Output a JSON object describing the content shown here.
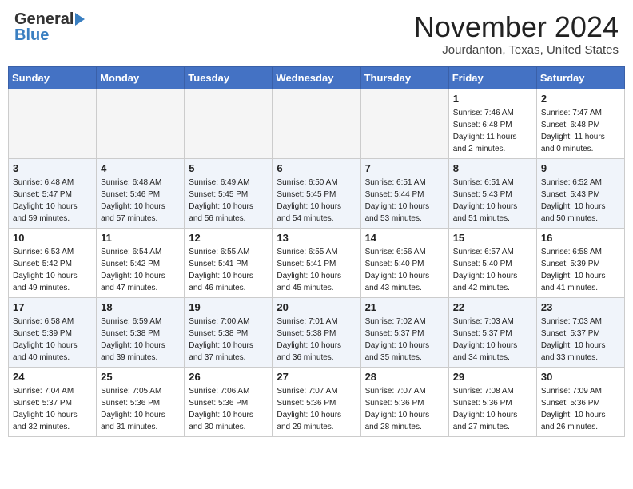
{
  "header": {
    "logo_general": "General",
    "logo_blue": "Blue",
    "month_title": "November 2024",
    "location": "Jourdanton, Texas, United States"
  },
  "weekdays": [
    "Sunday",
    "Monday",
    "Tuesday",
    "Wednesday",
    "Thursday",
    "Friday",
    "Saturday"
  ],
  "weeks": [
    [
      {
        "day": "",
        "info": ""
      },
      {
        "day": "",
        "info": ""
      },
      {
        "day": "",
        "info": ""
      },
      {
        "day": "",
        "info": ""
      },
      {
        "day": "",
        "info": ""
      },
      {
        "day": "1",
        "info": "Sunrise: 7:46 AM\nSunset: 6:48 PM\nDaylight: 11 hours\nand 2 minutes."
      },
      {
        "day": "2",
        "info": "Sunrise: 7:47 AM\nSunset: 6:48 PM\nDaylight: 11 hours\nand 0 minutes."
      }
    ],
    [
      {
        "day": "3",
        "info": "Sunrise: 6:48 AM\nSunset: 5:47 PM\nDaylight: 10 hours\nand 59 minutes."
      },
      {
        "day": "4",
        "info": "Sunrise: 6:48 AM\nSunset: 5:46 PM\nDaylight: 10 hours\nand 57 minutes."
      },
      {
        "day": "5",
        "info": "Sunrise: 6:49 AM\nSunset: 5:45 PM\nDaylight: 10 hours\nand 56 minutes."
      },
      {
        "day": "6",
        "info": "Sunrise: 6:50 AM\nSunset: 5:45 PM\nDaylight: 10 hours\nand 54 minutes."
      },
      {
        "day": "7",
        "info": "Sunrise: 6:51 AM\nSunset: 5:44 PM\nDaylight: 10 hours\nand 53 minutes."
      },
      {
        "day": "8",
        "info": "Sunrise: 6:51 AM\nSunset: 5:43 PM\nDaylight: 10 hours\nand 51 minutes."
      },
      {
        "day": "9",
        "info": "Sunrise: 6:52 AM\nSunset: 5:43 PM\nDaylight: 10 hours\nand 50 minutes."
      }
    ],
    [
      {
        "day": "10",
        "info": "Sunrise: 6:53 AM\nSunset: 5:42 PM\nDaylight: 10 hours\nand 49 minutes."
      },
      {
        "day": "11",
        "info": "Sunrise: 6:54 AM\nSunset: 5:42 PM\nDaylight: 10 hours\nand 47 minutes."
      },
      {
        "day": "12",
        "info": "Sunrise: 6:55 AM\nSunset: 5:41 PM\nDaylight: 10 hours\nand 46 minutes."
      },
      {
        "day": "13",
        "info": "Sunrise: 6:55 AM\nSunset: 5:41 PM\nDaylight: 10 hours\nand 45 minutes."
      },
      {
        "day": "14",
        "info": "Sunrise: 6:56 AM\nSunset: 5:40 PM\nDaylight: 10 hours\nand 43 minutes."
      },
      {
        "day": "15",
        "info": "Sunrise: 6:57 AM\nSunset: 5:40 PM\nDaylight: 10 hours\nand 42 minutes."
      },
      {
        "day": "16",
        "info": "Sunrise: 6:58 AM\nSunset: 5:39 PM\nDaylight: 10 hours\nand 41 minutes."
      }
    ],
    [
      {
        "day": "17",
        "info": "Sunrise: 6:58 AM\nSunset: 5:39 PM\nDaylight: 10 hours\nand 40 minutes."
      },
      {
        "day": "18",
        "info": "Sunrise: 6:59 AM\nSunset: 5:38 PM\nDaylight: 10 hours\nand 39 minutes."
      },
      {
        "day": "19",
        "info": "Sunrise: 7:00 AM\nSunset: 5:38 PM\nDaylight: 10 hours\nand 37 minutes."
      },
      {
        "day": "20",
        "info": "Sunrise: 7:01 AM\nSunset: 5:38 PM\nDaylight: 10 hours\nand 36 minutes."
      },
      {
        "day": "21",
        "info": "Sunrise: 7:02 AM\nSunset: 5:37 PM\nDaylight: 10 hours\nand 35 minutes."
      },
      {
        "day": "22",
        "info": "Sunrise: 7:03 AM\nSunset: 5:37 PM\nDaylight: 10 hours\nand 34 minutes."
      },
      {
        "day": "23",
        "info": "Sunrise: 7:03 AM\nSunset: 5:37 PM\nDaylight: 10 hours\nand 33 minutes."
      }
    ],
    [
      {
        "day": "24",
        "info": "Sunrise: 7:04 AM\nSunset: 5:37 PM\nDaylight: 10 hours\nand 32 minutes."
      },
      {
        "day": "25",
        "info": "Sunrise: 7:05 AM\nSunset: 5:36 PM\nDaylight: 10 hours\nand 31 minutes."
      },
      {
        "day": "26",
        "info": "Sunrise: 7:06 AM\nSunset: 5:36 PM\nDaylight: 10 hours\nand 30 minutes."
      },
      {
        "day": "27",
        "info": "Sunrise: 7:07 AM\nSunset: 5:36 PM\nDaylight: 10 hours\nand 29 minutes."
      },
      {
        "day": "28",
        "info": "Sunrise: 7:07 AM\nSunset: 5:36 PM\nDaylight: 10 hours\nand 28 minutes."
      },
      {
        "day": "29",
        "info": "Sunrise: 7:08 AM\nSunset: 5:36 PM\nDaylight: 10 hours\nand 27 minutes."
      },
      {
        "day": "30",
        "info": "Sunrise: 7:09 AM\nSunset: 5:36 PM\nDaylight: 10 hours\nand 26 minutes."
      }
    ]
  ]
}
